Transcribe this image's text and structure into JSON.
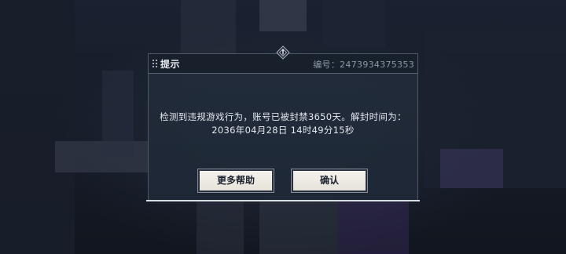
{
  "dialog": {
    "title": "提示",
    "id_text": "编号：2473934375353",
    "message_line1": "检测到违规游戏行为，账号已被封禁3650天。解封时间为：",
    "message_line2": "2036年04月28日 14时49分15秒",
    "buttons": {
      "help_label": "更多帮助",
      "confirm_label": "确认"
    }
  },
  "colors": {
    "dialog_bg": "#222c3a",
    "header_bg": "#161e2a",
    "text": "#e3e7ee",
    "id_text": "#8c98a8",
    "button_bg": "#f4f2ec",
    "button_text": "#1c232e",
    "bottom_line": "#d9dde4"
  },
  "icons": {
    "header_mark": "dotted-grip-icon",
    "top_emblem": "diamond-emblem-icon"
  }
}
